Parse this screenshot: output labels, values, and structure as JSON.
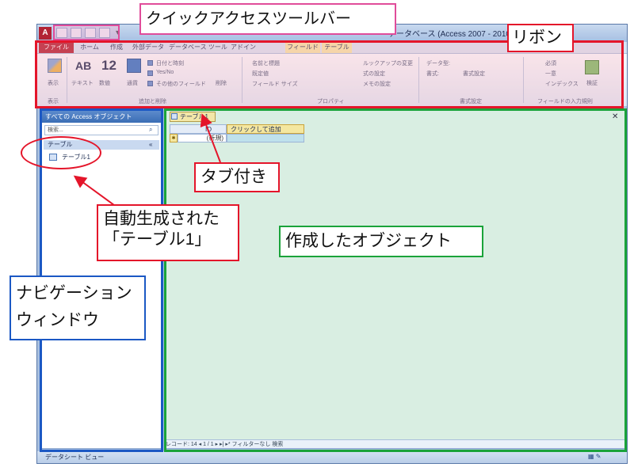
{
  "window": {
    "title": "データベース (Access 2007 - 2010)"
  },
  "qat": {
    "app_icon_letter": "A"
  },
  "ribbon": {
    "tabs": [
      "ファイル",
      "ホーム",
      "作成",
      "外部データ",
      "データベース ツール",
      "アドイン",
      "フィールド",
      "テーブル"
    ],
    "buttons": {
      "view": "表示",
      "text": "テキスト",
      "number": "数値",
      "currency": "通貨",
      "datetime": "日付と時刻",
      "yesno": "Yes/No",
      "other_fields": "その他のフィールド",
      "delete": "削除",
      "name_caption": "名前と標題",
      "default_value": "既定値",
      "field_size": "フィールド サイズ",
      "lookup": "ルックアップの変更",
      "expression": "式の設定",
      "memo": "メモの設定",
      "data_type": "データ型:",
      "format": "書式:",
      "format_setting": "書式設定",
      "required": "必須",
      "unique": "一意",
      "indexed": "インデックス",
      "validation": "検証"
    },
    "groups": [
      "表示",
      "追加と削除",
      "プロパティ",
      "書式設定",
      "フィールドの入力規則"
    ]
  },
  "nav": {
    "header": "すべての Access オブジェクト",
    "search_placeholder": "検索...",
    "group": "テーブル",
    "item": "テーブル1"
  },
  "document": {
    "tab_label": "テーブル1",
    "col_id": "ID",
    "col_add": "クリックして追加",
    "new_row": "(新規)",
    "record_nav": "レコード: 14 ◂ 1 / 1 ▸ ▸| ▸*   フィルターなし   検索"
  },
  "statusbar": {
    "text": "データシート ビュー"
  },
  "callouts": {
    "qat": "クイックアクセスツールバー",
    "ribbon": "リボン",
    "tabbed": "タブ付き",
    "auto_line1": "自動生成された",
    "auto_line2": "「テーブル1」",
    "object": "作成したオブジェクト",
    "nav_line1": "ナビゲーション",
    "nav_line2": "ウィンドウ"
  },
  "colors": {
    "ribbon_callout": "#e4152a",
    "qat_callout": "#e04c9a",
    "nav_callout": "#1b58c4",
    "object_callout": "#1aa33a",
    "file_tab": "#b22234"
  }
}
